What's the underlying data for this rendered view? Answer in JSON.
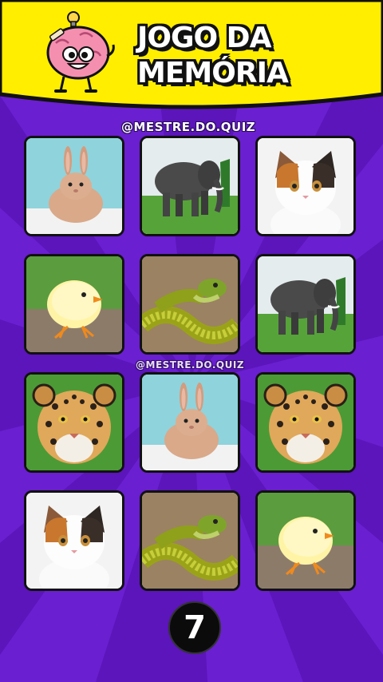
{
  "game": {
    "title_line1": "JOGO DA",
    "title_line2": "MEMÓRIA",
    "handle": "@MESTRE.DO.QUIZ",
    "watermark": "@MESTRE.DO.QUIZ",
    "countdown": "7"
  },
  "colors": {
    "header_yellow": "#ffee00",
    "background_purple": "#6a1fd0",
    "ray_purple": "#5a14b8"
  },
  "grid": [
    [
      "rabbit",
      "elephant",
      "cat"
    ],
    [
      "chick",
      "snake",
      "elephant"
    ],
    [
      "jaguar",
      "rabbit",
      "jaguar"
    ],
    [
      "cat",
      "snake",
      "chick"
    ]
  ]
}
